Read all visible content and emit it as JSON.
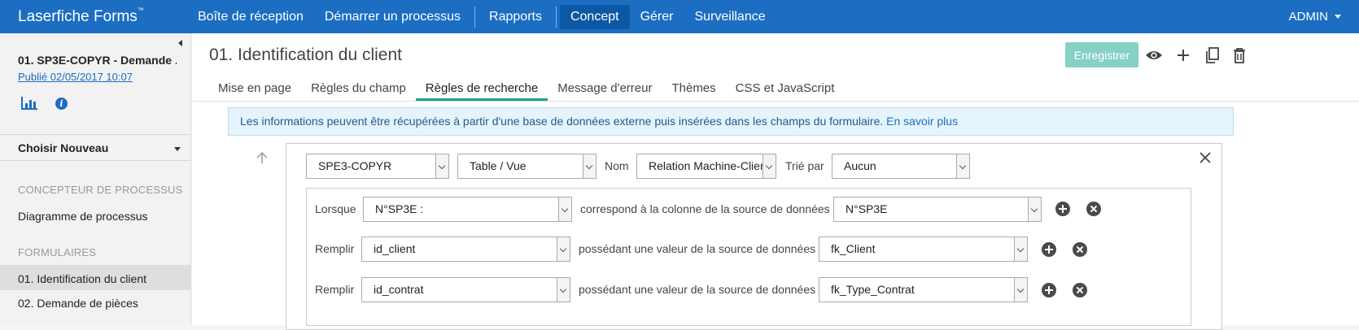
{
  "app": {
    "brand": "Laserfiche Forms",
    "brand_tm": "™"
  },
  "nav": {
    "items": [
      {
        "label": "Boîte de réception"
      },
      {
        "label": "Démarrer un processus"
      },
      {
        "label": "Rapports"
      },
      {
        "label": "Concept"
      },
      {
        "label": "Gérer"
      },
      {
        "label": "Surveillance"
      }
    ],
    "user": "ADMIN"
  },
  "sidebar": {
    "process_title": "01. SP3E-COPYR - Demande ...",
    "published": "Publié 02/05/2017 10:07",
    "choose": "Choisir Nouveau",
    "section_process": "CONCEPTEUR DE PROCESSUS",
    "process_diagram": "Diagramme de processus",
    "section_forms": "FORMULAIRES",
    "form_1": "01. Identification du client",
    "form_2": "02. Demande de pièces"
  },
  "main": {
    "title": "01. Identification du client",
    "save_label": "Enregistrer",
    "tabs": [
      {
        "label": "Mise en page"
      },
      {
        "label": "Règles du champ"
      },
      {
        "label": "Règles de recherche"
      },
      {
        "label": "Message d'erreur"
      },
      {
        "label": "Thèmes"
      },
      {
        "label": "CSS et JavaScript"
      }
    ],
    "banner_text": "Les informations peuvent être récupérées à partir d'une base de données externe puis insérées dans les champs du formulaire. ",
    "banner_link": "En savoir plus"
  },
  "rule": {
    "datasource": "SPE3-COPYR",
    "type": "Table / Vue",
    "name_label": "Nom",
    "name_value": "Relation Machine-Client",
    "sort_label": "Trié par",
    "sort_value": "Aucun",
    "when_label": "Lorsque",
    "when_field": "N°SP3E :",
    "when_text": "correspond à la colonne de la source de données",
    "when_column": "N°SP3E",
    "fill_rows": [
      {
        "label": "Remplir",
        "field": "id_client",
        "text": "possédant une valeur de la source de données",
        "column": "fk_Client"
      },
      {
        "label": "Remplir",
        "field": "id_contrat",
        "text": "possédant une valeur de la source de données",
        "column": "fk_Type_Contrat"
      }
    ]
  }
}
